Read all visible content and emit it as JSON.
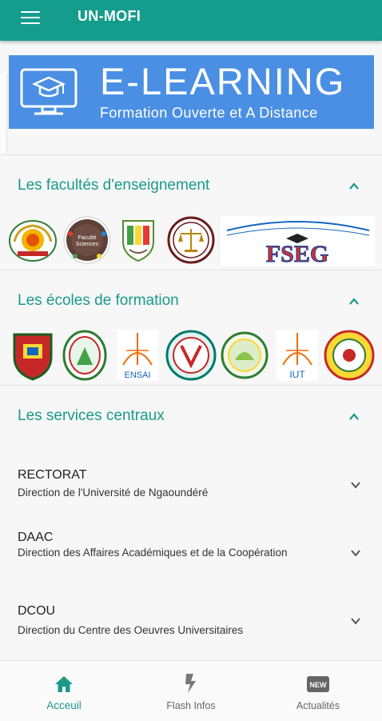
{
  "appbar": {
    "title": "UN-MOFI"
  },
  "banner": {
    "big": "E-LEARNING",
    "small": "Formation Ouverte et A Distance"
  },
  "faculties": {
    "title": "Les facultés d'enseignement",
    "seal_text": "FSEG",
    "logo2_text": "Faculté des Sciences"
  },
  "schools": {
    "title": "Les écoles de formation",
    "logo3_text": "ENSAI",
    "logo6_text": "IUT"
  },
  "services": {
    "title": "Les services centraux",
    "items": [
      {
        "name": "RECTORAT",
        "desc": "Direction de l'Université de Ngaoundéré"
      },
      {
        "name": "DAAC",
        "desc": "Direction des Affaires Académiques et de la Coopération"
      },
      {
        "name": "DCOU",
        "desc": "Direction du Centre des Oeuvres Universitaires"
      }
    ]
  },
  "bottom_nav": [
    {
      "label": "Acceuil",
      "icon": "home-icon",
      "active": true
    },
    {
      "label": "Flash Infos",
      "icon": "flash-icon",
      "active": false
    },
    {
      "label": "Actualités",
      "icon": "new-badge-icon",
      "active": false
    }
  ],
  "colors": {
    "primary": "#149c8c",
    "accent_text": "#1a9a8a",
    "banner": "#4a8fe4"
  }
}
